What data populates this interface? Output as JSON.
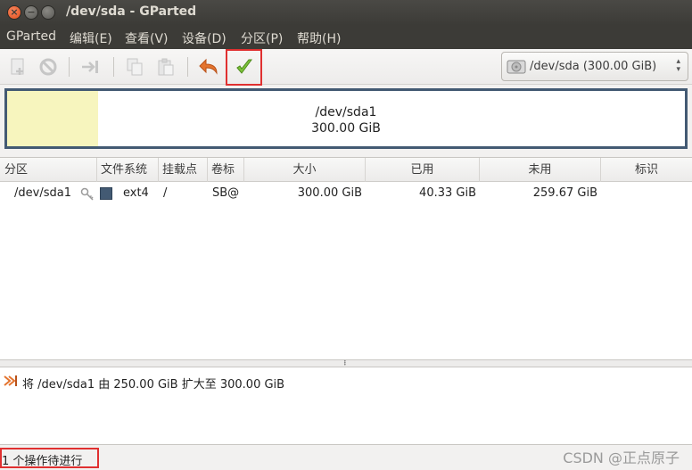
{
  "window": {
    "title": "/dev/sda - GParted"
  },
  "menu": {
    "items": [
      "GParted",
      "编辑(E)",
      "查看(V)",
      "设备(D)",
      "分区(P)",
      "帮助(H)"
    ]
  },
  "toolbar": {
    "buttons": [
      {
        "icon": "new-partition-icon",
        "enabled": false
      },
      {
        "icon": "delete-icon",
        "enabled": false
      },
      {
        "icon": "resize-move-icon",
        "enabled": false
      },
      {
        "icon": "copy-icon",
        "enabled": false
      },
      {
        "icon": "paste-icon",
        "enabled": false
      },
      {
        "icon": "undo-icon",
        "enabled": true
      },
      {
        "icon": "apply-check-icon",
        "enabled": true
      }
    ],
    "device": "/dev/sda  (300.00 GiB)"
  },
  "disk_graphic": {
    "partition_name": "/dev/sda1",
    "partition_size": "300.00 GiB",
    "used_fraction": 0.134,
    "fill_color": "#f7f5be",
    "border_color": "#435a73"
  },
  "table": {
    "headers": [
      "分区",
      "文件系统",
      "挂载点",
      "卷标",
      "大小",
      "已用",
      "未用",
      "标识"
    ],
    "rows": [
      {
        "partition": "/dev/sda1",
        "filesystem": "ext4",
        "mountpoint": "/",
        "label": "SB@",
        "size": "300.00 GiB",
        "used": "40.33 GiB",
        "unused": "259.67 GiB",
        "flags": ""
      }
    ]
  },
  "operations": {
    "items": [
      "将 /dev/sda1 由 250.00 GiB 扩大至 300.00 GiB"
    ]
  },
  "status": {
    "text": "1 个操作待进行"
  },
  "watermark": "CSDN @正点原子"
}
